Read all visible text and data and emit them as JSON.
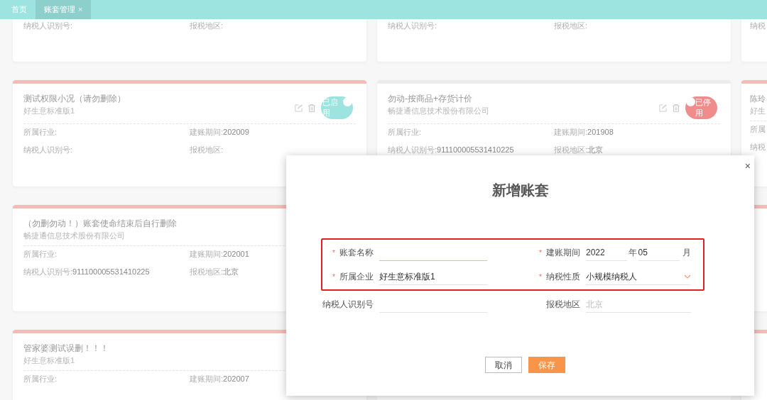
{
  "tabs": [
    {
      "label": "首页",
      "selected": false
    },
    {
      "label": "账套管理",
      "selected": true,
      "close": "×"
    }
  ],
  "card_rows": [
    [
      {
        "cut_top": true,
        "fields": [
          {
            "label": "纳税人识别号:"
          },
          {
            "label": "报税地区:"
          }
        ]
      },
      {
        "cut_top": true,
        "fields": [
          {
            "label": "纳税人识别号:"
          },
          {
            "label": "报税地区:"
          }
        ]
      },
      {
        "cut_top": true,
        "fields": [
          {
            "label": "纳税"
          }
        ]
      }
    ],
    [
      {
        "title": "测试权限小况（请勿删除）",
        "subtitle": "好生意标准版1",
        "enabled": true,
        "status": "已启用",
        "fields": [
          {
            "label": "所属行业:"
          },
          {
            "label": "建账期间:",
            "value": "202009"
          },
          {
            "label": "纳税人识别号:"
          },
          {
            "label": "报税地区:"
          }
        ]
      },
      {
        "title": "勿动-按商品+存货计价",
        "subtitle": "畅捷通信息技术股份有限公司",
        "enabled": false,
        "status": "已停用",
        "fields": [
          {
            "label": "所属行业:"
          },
          {
            "label": "建账期间:",
            "value": "201908"
          },
          {
            "label": "纳税人识别号:",
            "value": "911100005531410225"
          },
          {
            "label": "报税地区:",
            "value": "北京"
          }
        ]
      },
      {
        "title": "陈玲",
        "subtitle": "好生",
        "enabled": true,
        "fields": [
          {
            "label": "所属"
          },
          {
            "label": "纳税"
          }
        ]
      }
    ],
    [
      {
        "title": "（勿删勿动！）账套使命结束后自行删除",
        "subtitle": "畅捷通信息技术股份有限公司",
        "enabled": true,
        "fields": [
          {
            "label": "所属行业:"
          },
          {
            "label": "建账期间:",
            "value": "202001"
          },
          {
            "label": "纳税人识别号:",
            "value": "911100005531410225"
          },
          {
            "label": "报税地区:",
            "value": "北京"
          }
        ]
      },
      null,
      {
        "enabled": true
      }
    ],
    [
      {
        "title": "管家婆测试误删！！！",
        "subtitle": "好生意标准版1",
        "enabled": true,
        "fields": [
          {
            "label": "所属行业:"
          },
          {
            "label": "建账期间:",
            "value": "202007"
          }
        ]
      },
      null,
      {
        "enabled": true
      }
    ]
  ],
  "dialog": {
    "title": "新增账套",
    "close": "×",
    "rows": [
      {
        "highlighted": true,
        "fields": [
          {
            "kind": "text",
            "mark": "*",
            "label": "账套名称",
            "focused": true
          },
          {
            "kind": "period",
            "mark": "*",
            "label": "建账期间",
            "year": "2022",
            "year_unit": "年",
            "month": "05",
            "month_unit": "月"
          }
        ]
      },
      {
        "highlighted": true,
        "fields": [
          {
            "kind": "text",
            "mark": "*",
            "label": "所属企业",
            "value": "好生意标准版1",
            "focused": false
          },
          {
            "kind": "select",
            "mark": "*",
            "label": "纳税性质",
            "value": "小规模纳税人"
          }
        ]
      },
      {
        "highlighted": false,
        "fields": [
          {
            "kind": "text",
            "label": "纳税人识别号",
            "focused": false
          },
          {
            "kind": "text",
            "label": "报税地区",
            "placeholder": "北京",
            "focused": false
          }
        ]
      }
    ],
    "buttons": [
      {
        "label": "取消",
        "kind": "secondary"
      },
      {
        "label": "保存",
        "kind": "primary"
      }
    ]
  }
}
